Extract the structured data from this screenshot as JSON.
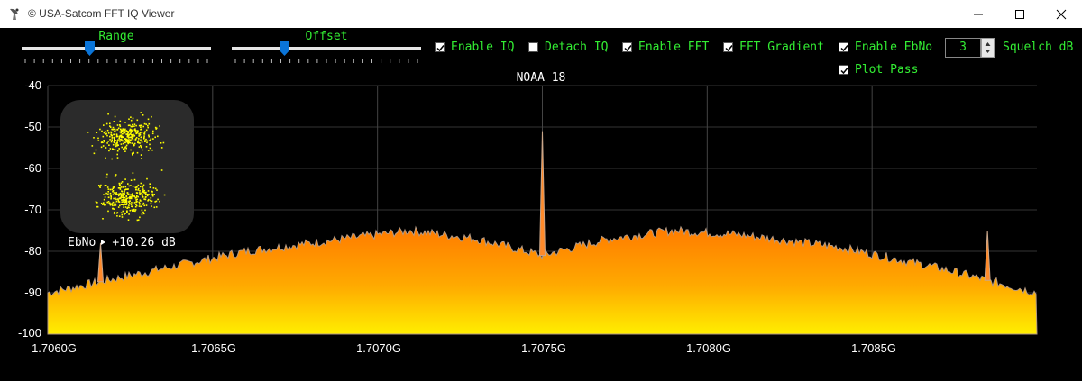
{
  "window": {
    "title": "© USA-Satcom FFT IQ Viewer"
  },
  "controls": {
    "range": {
      "label": "Range",
      "value": 0.36
    },
    "offset": {
      "label": "Offset",
      "value": 0.28
    },
    "checkboxes": [
      {
        "label": "Enable IQ",
        "checked": true
      },
      {
        "label": "Detach IQ",
        "checked": false
      },
      {
        "label": "Enable FFT",
        "checked": true
      },
      {
        "label": "FFT Gradient",
        "checked": true
      },
      {
        "label": "Enable EbNo",
        "checked": true
      },
      {
        "label": "Plot Pass",
        "checked": true
      }
    ],
    "squelch": {
      "value": "3",
      "label": "Squelch dB"
    }
  },
  "plot": {
    "title": "NOAA 18",
    "y_ticks": [
      "-40",
      "-50",
      "-60",
      "-70",
      "-80",
      "-90",
      "-100"
    ],
    "x_ticks": [
      "1.7060G",
      "1.7065G",
      "1.7070G",
      "1.7075G",
      "1.7080G",
      "1.7085G"
    ],
    "ebno_label": "EbNo",
    "ebno_value": "+10.26 dB"
  },
  "chart_data": {
    "type": "area",
    "ylim": [
      -100,
      -40
    ],
    "x_range_ghz": [
      1.706,
      1.709
    ],
    "y_ticks": [
      -40,
      -50,
      -60,
      -70,
      -80,
      -90,
      -100
    ],
    "x_ticks": [
      1.706,
      1.7065,
      1.707,
      1.7075,
      1.708,
      1.7085
    ],
    "envelope": [
      {
        "x": 1.706,
        "y": -90
      },
      {
        "x": 1.7063,
        "y": -85
      },
      {
        "x": 1.7066,
        "y": -80
      },
      {
        "x": 1.7069,
        "y": -77
      },
      {
        "x": 1.7071,
        "y": -75
      },
      {
        "x": 1.7073,
        "y": -77
      },
      {
        "x": 1.7075,
        "y": -81
      },
      {
        "x": 1.7077,
        "y": -77
      },
      {
        "x": 1.7079,
        "y": -75
      },
      {
        "x": 1.7081,
        "y": -76
      },
      {
        "x": 1.7084,
        "y": -79
      },
      {
        "x": 1.7087,
        "y": -84
      },
      {
        "x": 1.709,
        "y": -90
      }
    ],
    "peaks": [
      {
        "x": 1.70616,
        "y": -78
      },
      {
        "x": 1.7075,
        "y": -51
      },
      {
        "x": 1.70885,
        "y": -75
      }
    ],
    "grid": true
  },
  "colors": {
    "accent_green": "#33ee33",
    "fill_top": "#ff7a00",
    "fill_bottom": "#ffee00",
    "peak": "#ff8a2a",
    "grid": "#333333",
    "iq_points": "#ffff00"
  }
}
